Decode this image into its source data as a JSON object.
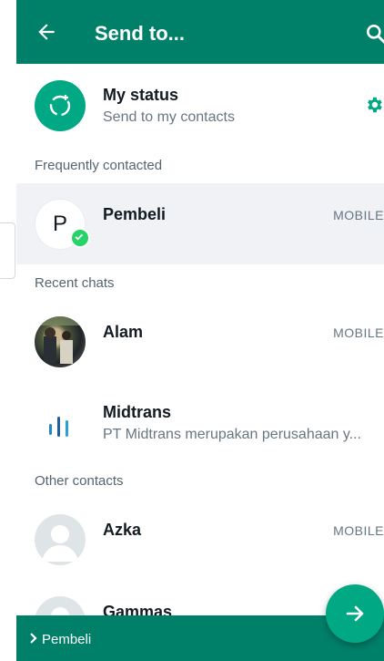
{
  "header": {
    "title": "Send to..."
  },
  "my_status": {
    "title": "My status",
    "subtitle": "Send to my contacts"
  },
  "sections": {
    "frequent": "Frequently contacted",
    "recent": "Recent chats",
    "other": "Other contacts"
  },
  "frequent_contacts": [
    {
      "initial": "P",
      "name": "Pembeli",
      "tag": "MOBILE",
      "selected": true
    }
  ],
  "recent_chats": [
    {
      "name": "Alam",
      "tag": "MOBILE"
    },
    {
      "name": "Midtrans",
      "subtitle": "PT Midtrans merupakan perusahaan y..."
    }
  ],
  "other_contacts": [
    {
      "name": "Azka",
      "tag": "MOBILE"
    },
    {
      "name": "Gammas"
    }
  ],
  "selection_bar": {
    "label": "Pembeli"
  },
  "colors": {
    "primary": "#008069",
    "accent": "#00a884",
    "check": "#25d366"
  }
}
